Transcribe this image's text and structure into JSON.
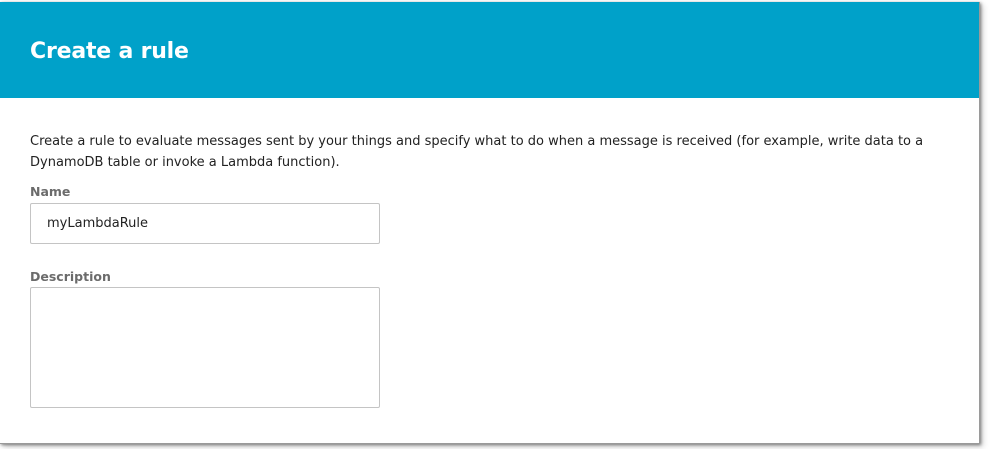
{
  "dialog": {
    "title": "Create a rule",
    "intro": "Create a rule to evaluate messages sent by your things and specify what to do when a message is received (for example, write data to a DynamoDB table or invoke a Lambda function).",
    "colors": {
      "header_bg": "#00a1c9",
      "header_text": "#ffffff",
      "label_text": "#6b6b6b",
      "input_border": "#c4c4c4"
    }
  },
  "form": {
    "name": {
      "label": "Name",
      "value": "myLambdaRule"
    },
    "description": {
      "label": "Description",
      "value": ""
    }
  }
}
